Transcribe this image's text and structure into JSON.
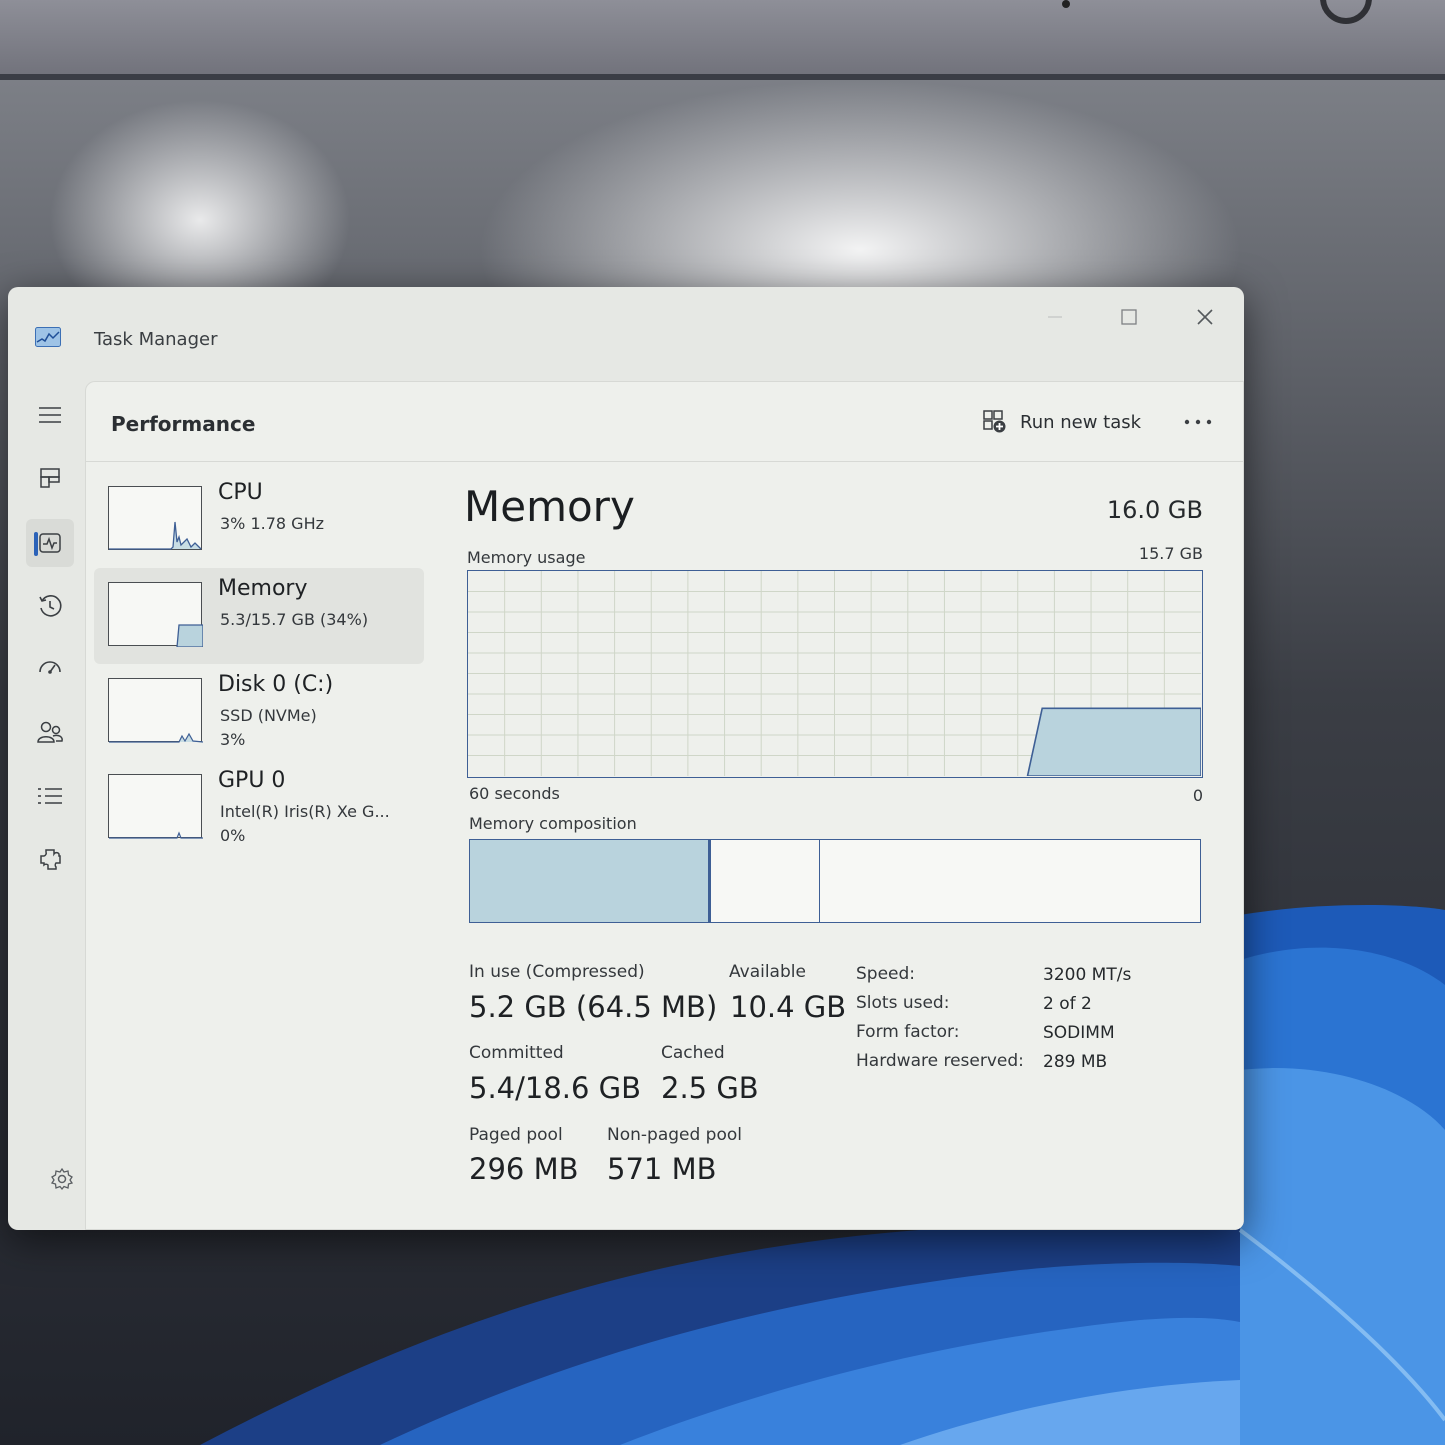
{
  "window": {
    "title": "Task Manager"
  },
  "nav": {
    "items": [
      {
        "name": "hamburger-menu-icon",
        "active": false
      },
      {
        "name": "processes-icon",
        "active": false
      },
      {
        "name": "performance-icon",
        "active": true
      },
      {
        "name": "app-history-icon",
        "active": false
      },
      {
        "name": "startup-apps-icon",
        "active": false
      },
      {
        "name": "users-icon",
        "active": false
      },
      {
        "name": "details-icon",
        "active": false
      },
      {
        "name": "services-icon",
        "active": false
      }
    ],
    "settings_icon": "settings-gear-icon"
  },
  "header": {
    "title": "Performance",
    "run_new_task": "Run new task",
    "more_icon": "more-options-icon"
  },
  "devices": [
    {
      "name": "CPU",
      "line1": "3% 1.78 GHz",
      "line2": "",
      "selected": false
    },
    {
      "name": "Memory",
      "line1": "5.3/15.7 GB (34%)",
      "line2": "",
      "selected": true
    },
    {
      "name": "Disk 0 (C:)",
      "line1": "SSD (NVMe)",
      "line2": "3%",
      "selected": false
    },
    {
      "name": "GPU 0",
      "line1": "Intel(R) Iris(R) Xe G...",
      "line2": "0%",
      "selected": false
    }
  ],
  "memory": {
    "heading": "Memory",
    "total": "16.0 GB",
    "usage_label": "Memory usage",
    "usage_max": "15.7 GB",
    "axis_left": "60 seconds",
    "axis_right": "0",
    "composition_label": "Memory composition",
    "composition": {
      "in_use": 0.33,
      "modified": 0.15,
      "standby_free": 0.52
    },
    "usage_history_fraction": [
      0,
      0,
      0,
      0,
      0,
      0,
      0,
      0,
      0,
      0,
      0,
      0,
      0.33,
      0.33,
      0.33,
      0.33
    ],
    "stats": {
      "in_use_label": "In use (Compressed)",
      "in_use_value": "5.2 GB (64.5 MB)",
      "available_label": "Available",
      "available_value": "10.4 GB",
      "committed_label": "Committed",
      "committed_value": "5.4/18.6 GB",
      "cached_label": "Cached",
      "cached_value": "2.5 GB",
      "paged_label": "Paged pool",
      "paged_value": "296 MB",
      "nonpaged_label": "Non-paged pool",
      "nonpaged_value": "571 MB"
    },
    "specs": {
      "speed_label": "Speed:",
      "speed_value": "3200 MT/s",
      "slots_label": "Slots used:",
      "slots_value": "2 of 2",
      "form_label": "Form factor:",
      "form_value": "SODIMM",
      "reserved_label": "Hardware reserved:",
      "reserved_value": "289 MB"
    }
  },
  "colors": {
    "accent": "#2b62b8",
    "graph_line": "#3e5f95",
    "graph_fill": "#b9d3dd",
    "grid": "#cfd6c8"
  }
}
